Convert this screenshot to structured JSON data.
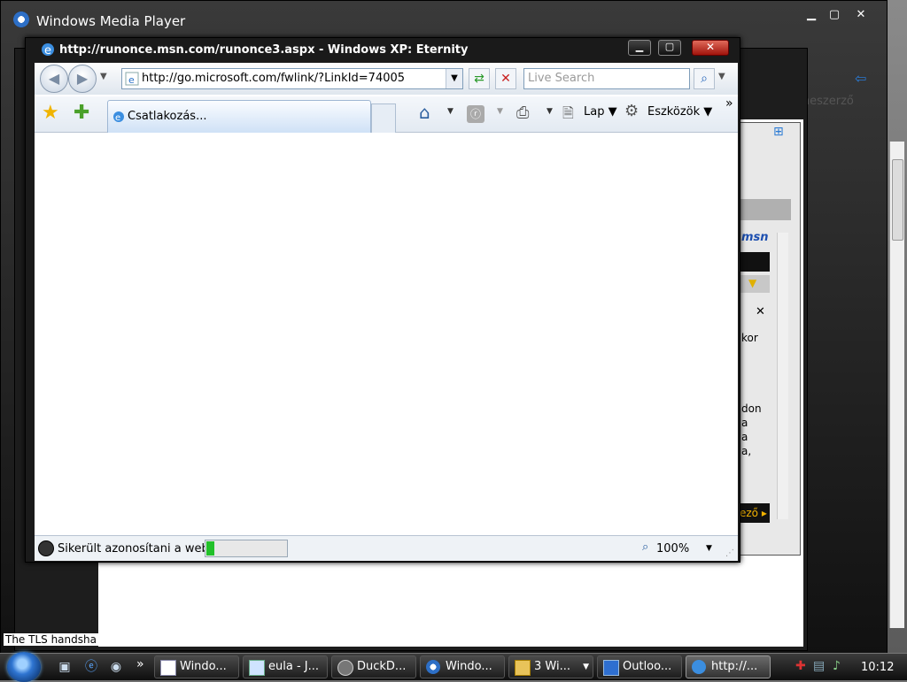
{
  "wmp": {
    "title": "Windows Media Player",
    "right_label": "Zeneszerző"
  },
  "midwin": {
    "status_text": "The TLS handsha"
  },
  "msn": {
    "logo": "msn",
    "text_lines": [
      "kor",
      "don",
      "a",
      "a",
      "a,"
    ],
    "footer": "ező"
  },
  "ie": {
    "title": "http://runonce.msn.com/runonce3.aspx - Windows XP: Eternity",
    "address": "http://go.microsoft.com/fwlink/?LinkId=74005",
    "search_placeholder": "Live Search",
    "tab_label": "Csatlakozás...",
    "page_menu": "Lap",
    "tools_menu": "Eszközök",
    "chevron": "»",
    "status_text": "Sikerült azonosítani a webh",
    "progress": 0.1,
    "zoom": "100%"
  },
  "taskbar": {
    "quicklaunch_chevron": "»",
    "buttons": [
      {
        "label": "Windo...",
        "icon": "window-icon"
      },
      {
        "label": "eula - J...",
        "icon": "document-icon"
      },
      {
        "label": "DuckD...",
        "icon": "duck-icon"
      },
      {
        "label": "Windo...",
        "icon": "media-player-icon"
      },
      {
        "label": "3 Wi...",
        "icon": "folder-icon"
      },
      {
        "label": "Outloo...",
        "icon": "outlook-icon"
      },
      {
        "label": "http://...",
        "icon": "ie-icon"
      }
    ],
    "clock": "10:12"
  }
}
